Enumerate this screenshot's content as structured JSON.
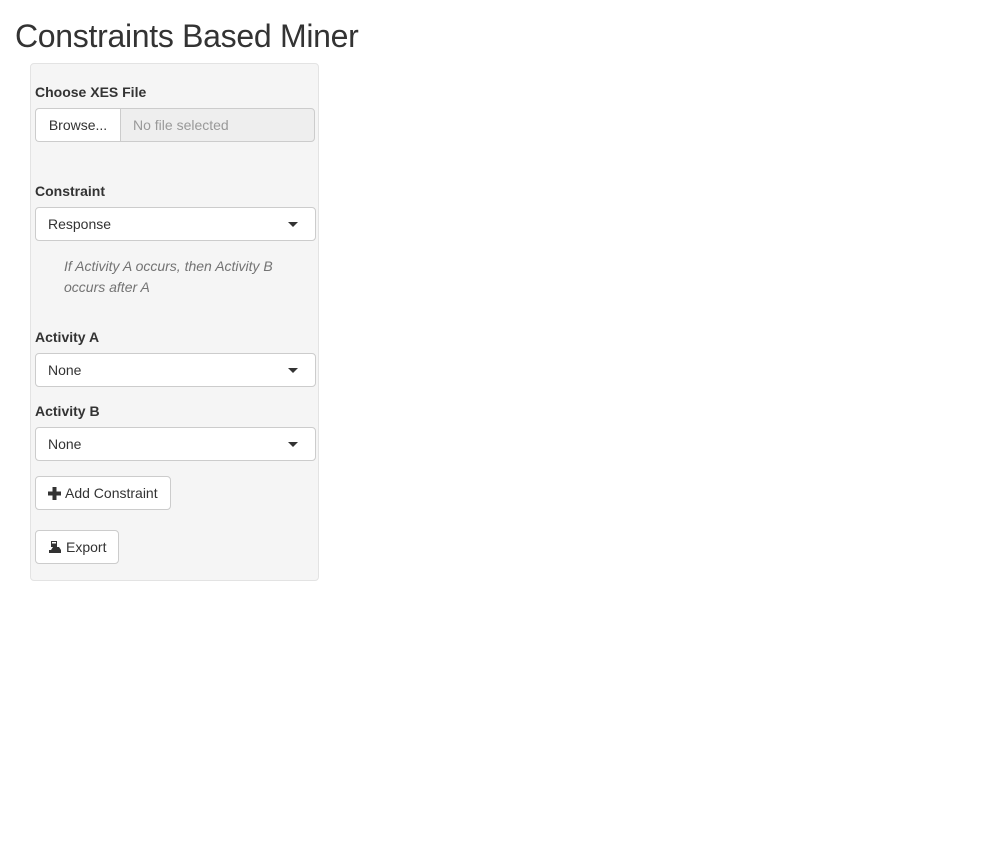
{
  "page": {
    "title": "Constraints Based Miner"
  },
  "sidebar": {
    "file_input": {
      "label": "Choose XES File",
      "browse_label": "Browse...",
      "placeholder": "No file selected"
    },
    "constraint": {
      "label": "Constraint",
      "selected": "Response",
      "description": "If Activity A occurs, then Activity B occurs after A"
    },
    "activity_a": {
      "label": "Activity A",
      "selected": "None"
    },
    "activity_b": {
      "label": "Activity B",
      "selected": "None"
    },
    "add_constraint_button": {
      "label": "Add Constraint",
      "icon": "plus-icon"
    },
    "export_button": {
      "label": "Export",
      "icon": "export-icon"
    }
  },
  "colors": {
    "panel_background": "#f5f5f5",
    "panel_border": "#e3e3e3",
    "input_border": "#cccccc",
    "help_text": "#737373",
    "placeholder": "#999999"
  }
}
